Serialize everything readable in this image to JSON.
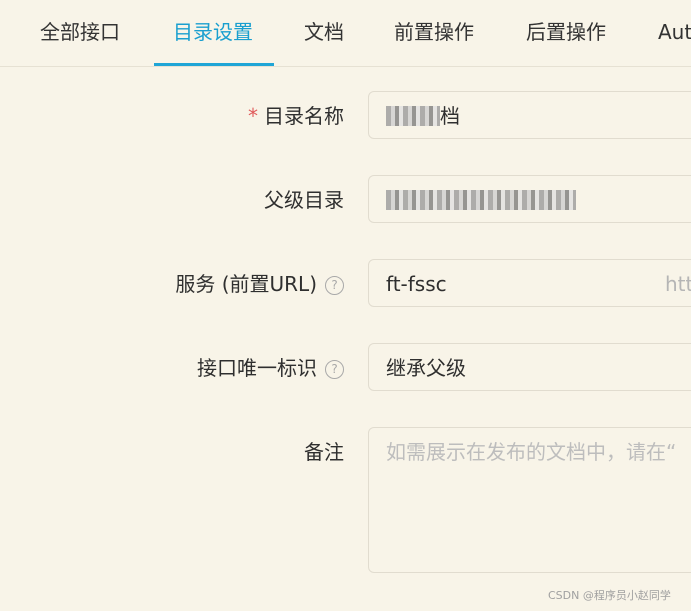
{
  "tabs": [
    {
      "label": "全部接口"
    },
    {
      "label": "目录设置"
    },
    {
      "label": "文档"
    },
    {
      "label": "前置操作"
    },
    {
      "label": "后置操作"
    },
    {
      "label": "Aut"
    }
  ],
  "form": {
    "required_mark": "*",
    "directory_name": {
      "label": "目录名称",
      "value": "档"
    },
    "parent_directory": {
      "label": "父级目录",
      "value": ""
    },
    "service": {
      "label": "服务 (前置URL)",
      "help_glyph": "?",
      "value": "ft-fssc",
      "suffix": "htt"
    },
    "api_unique_id": {
      "label": "接口唯一标识",
      "help_glyph": "?",
      "value": "继承父级"
    },
    "remark": {
      "label": "备注",
      "placeholder": "如需展示在发布的文档中，请在“"
    }
  },
  "footer": {
    "text": "CSDN @程序员小赵同学"
  }
}
